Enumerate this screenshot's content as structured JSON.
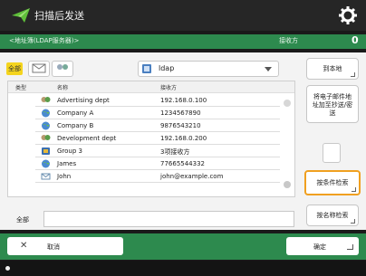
{
  "app": {
    "title": "扫描后发送"
  },
  "status": {
    "address_book_label": "<地址簿(LDAP服务器)>",
    "destinations_label": "接收方",
    "destinations_count": "0"
  },
  "filters": {
    "all_label": "全部"
  },
  "server_select": {
    "value": "ldap"
  },
  "list": {
    "headers": {
      "type": "类型",
      "name": "名称",
      "address": "接收方"
    },
    "rows": [
      {
        "icon": "group-icon",
        "name": "Advertising dept",
        "address": "192.168.0.100"
      },
      {
        "icon": "globe-icon",
        "name": "Company A",
        "address": "1234567890"
      },
      {
        "icon": "globe-icon",
        "name": "Company B",
        "address": "9876543210"
      },
      {
        "icon": "group-icon",
        "name": "Development dept",
        "address": "192.168.0.200"
      },
      {
        "icon": "book-icon",
        "name": "Group 3",
        "address": "3项接收方"
      },
      {
        "icon": "globe-icon",
        "name": "James",
        "address": "77665544332"
      },
      {
        "icon": "email-icon",
        "name": "John",
        "address": "john@example.com"
      }
    ]
  },
  "side_buttons": {
    "to_local": "到本地",
    "email_include": "将电子邮件地址加至抄送/密送",
    "search_by_condition": "按条件检索",
    "search_by_name": "按名称检索"
  },
  "search": {
    "label": "全部"
  },
  "footer": {
    "cancel": "取消",
    "ok": "确定"
  },
  "colors": {
    "accent_green": "#2d8a4e",
    "highlight_orange": "#f0a020",
    "filter_yellow": "#f4d41e"
  }
}
